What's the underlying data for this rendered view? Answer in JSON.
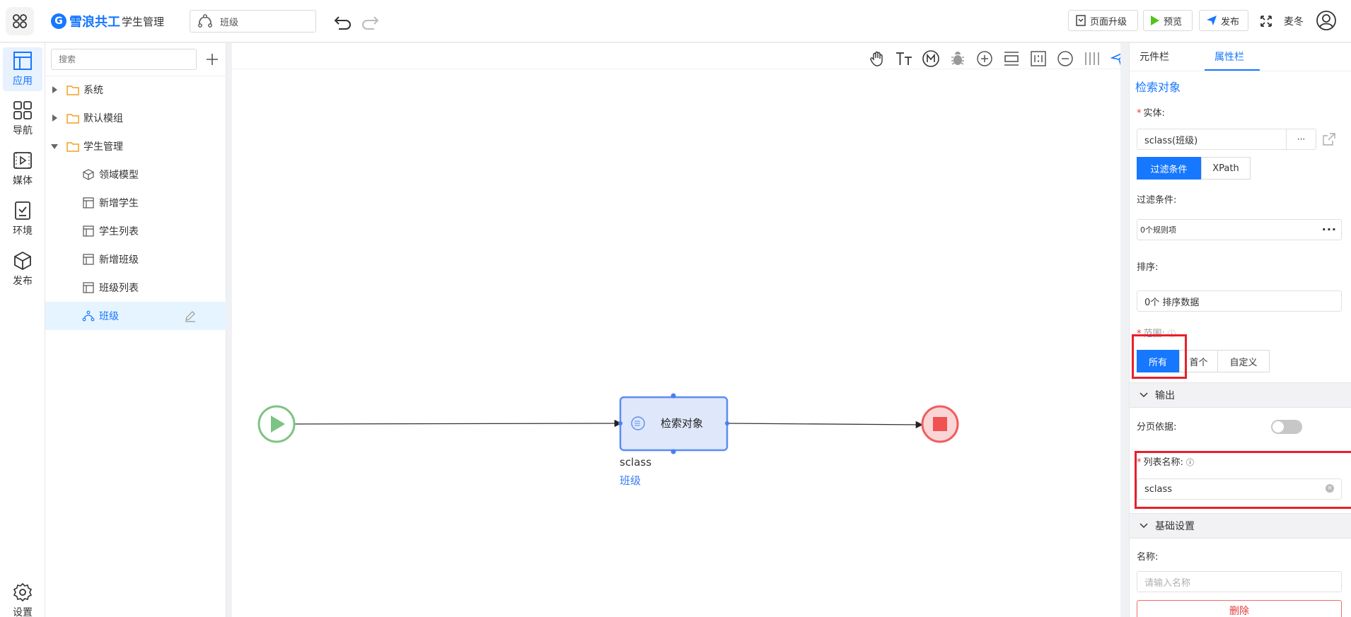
{
  "header": {
    "brand": "雪浪共工",
    "app_name": "学生管理",
    "page_selector_value": "班级",
    "buttons": {
      "upgrade": "页面升级",
      "preview": "预览",
      "publish": "发布"
    },
    "user_name": "麦冬"
  },
  "nav": {
    "items": [
      {
        "label": "应用",
        "icon": "app-layout-icon",
        "active": true
      },
      {
        "label": "导航",
        "icon": "grid-icon"
      },
      {
        "label": "媒体",
        "icon": "media-icon"
      },
      {
        "label": "环境",
        "icon": "environment-icon"
      },
      {
        "label": "发布",
        "icon": "cube-icon"
      }
    ],
    "settings_label": "设置"
  },
  "tree": {
    "search_placeholder": "搜索",
    "folders": {
      "system": "系统",
      "default_module": "默认模组",
      "student_mgmt": "学生管理"
    },
    "children": [
      "领域模型",
      "新增学生",
      "学生列表",
      "新增班级",
      "班级列表"
    ],
    "selected": "班级"
  },
  "canvas": {
    "node": {
      "title": "检索对象",
      "entity": "sclass",
      "entity_label": "班级"
    }
  },
  "panel": {
    "tabs": [
      "元件栏",
      "属性栏"
    ],
    "active_tab": "属性栏",
    "title": "检索对象",
    "entity_label": "实体:",
    "entity_value": "sclass(班级)",
    "entity_more": "···",
    "filter_tabs": [
      "过滤条件",
      "XPath"
    ],
    "filter_label": "过滤条件:",
    "filter_value": "0个规则项",
    "sort_label": "排序:",
    "sort_value": "0个 排序数据",
    "range_label": "范围:",
    "range_options": [
      "所有",
      "首个",
      "自定义"
    ],
    "output_section": "输出",
    "paging_label": "分页依据:",
    "list_name_label": "列表名称:",
    "list_name_value": "sclass",
    "basic_section": "基础设置",
    "name_label": "名称:",
    "name_placeholder": "请输入名称",
    "delete_label": "删除"
  },
  "colors": {
    "accent": "#1677ff",
    "start": "#7dc383",
    "end": "#f25b5b",
    "highlight": "#e8202a"
  }
}
